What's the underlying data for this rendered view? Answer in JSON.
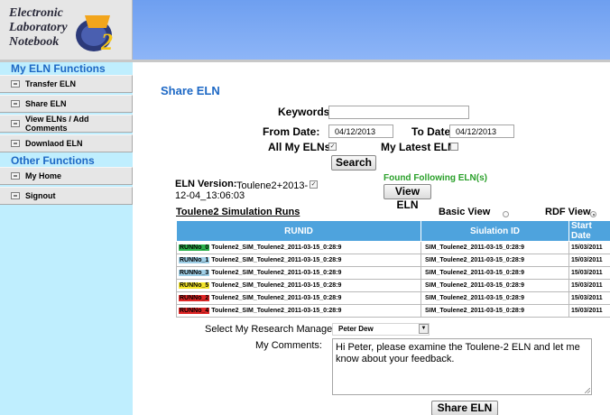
{
  "header": {
    "logo_text": "Electronic\nLaboratory\nNotebook",
    "logo_badge": "2",
    "background_color": "#7aa8f2"
  },
  "sidebar": {
    "sections": [
      {
        "heading": "My ELN Functions",
        "items": [
          {
            "label": "Transfer ELN",
            "icon": "folder-icon"
          },
          {
            "label": "Share ELN",
            "icon": "folder-icon"
          },
          {
            "label": "View ELNs / Add Comments",
            "icon": "folder-icon"
          },
          {
            "label": "Downlaod ELN",
            "icon": "folder-icon"
          }
        ]
      },
      {
        "heading": "Other Functions",
        "items": [
          {
            "label": "My Home",
            "icon": "folder-icon"
          },
          {
            "label": "Signout",
            "icon": "folder-icon"
          }
        ]
      }
    ],
    "background_color": "#bfeefe"
  },
  "main": {
    "title": "Share ELN",
    "search": {
      "keywords_label": "Keywords:",
      "keywords_value": "",
      "from_date_label": "From Date:",
      "from_date_value": "04/12/2013",
      "to_date_label": "To Date:",
      "to_date_value": "04/12/2013",
      "all_my_elns_label": "All My ELNs:",
      "all_my_elns_checked": true,
      "my_latest_eln_label": "My Latest ELN:",
      "my_latest_eln_checked": false,
      "search_button": "Search"
    },
    "eln_version": {
      "label": "ELN Version:",
      "value_line1": "Toulene2+2013-",
      "value_line2": "12-04_13:06:03",
      "checked": true
    },
    "found_text": "Found Following ELN(s)",
    "view_eln_button": "View ELN",
    "runs": {
      "title": "Toulene2 Simulation Runs",
      "basic_view_label": "Basic View",
      "basic_view_selected": false,
      "rdf_view_label": "RDF View",
      "rdf_view_selected": true,
      "columns": [
        "RUNID",
        "Siulation ID",
        "Start Date"
      ],
      "rows": [
        {
          "tag": "RUNNo_0",
          "tag_color": "#2bb24c",
          "runid": "Toulene2_SIM_Toulene2_2011-03-15_0:28:9",
          "sim_id": "SIM_Toulene2_2011-03-15_0:28:9",
          "start": "15/03/2011"
        },
        {
          "tag": "RUNNo_1",
          "tag_color": "#9fd0e8",
          "runid": "Toulene2_SIM_Toulene2_2011-03-15_0:28:9",
          "sim_id": "SIM_Toulene2_2011-03-15_0:28:9",
          "start": "15/03/2011"
        },
        {
          "tag": "RUNNo_3",
          "tag_color": "#9fd0e8",
          "runid": "Toulene2_SIM_Toulene2_2011-03-15_0:28:9",
          "sim_id": "SIM_Toulene2_2011-03-15_0:28:9",
          "start": "15/03/2011"
        },
        {
          "tag": "RUNNo_5",
          "tag_color": "#f5e62a",
          "runid": "Toulene2_SIM_Toulene2_2011-03-15_0:28:9",
          "sim_id": "SIM_Toulene2_2011-03-15_0:28:9",
          "start": "15/03/2011"
        },
        {
          "tag": "RUNNo_2",
          "tag_color": "#e02626",
          "runid": "Toulene2_SIM_Toulene2_2011-03-15_0:28:9",
          "sim_id": "SIM_Toulene2_2011-03-15_0:28:9",
          "start": "15/03/2011"
        },
        {
          "tag": "RUNNo_4",
          "tag_color": "#e02626",
          "runid": "Toulene2_SIM_Toulene2_2011-03-15_0:28:9",
          "sim_id": "SIM_Toulene2_2011-03-15_0:28:9",
          "start": "15/03/2011"
        }
      ]
    },
    "manager": {
      "label": "Select My Research Manager:",
      "value": "Peter Dew"
    },
    "comments": {
      "label": "My Comments:",
      "value": "Hi Peter, please examine the Toulene-2 ELN and let me know about your feedback."
    },
    "share_button": "Share ELN"
  },
  "colors": {
    "accent": "#1d68c5",
    "table_header": "#4ea3dd",
    "found_text": "#2aa02a"
  }
}
